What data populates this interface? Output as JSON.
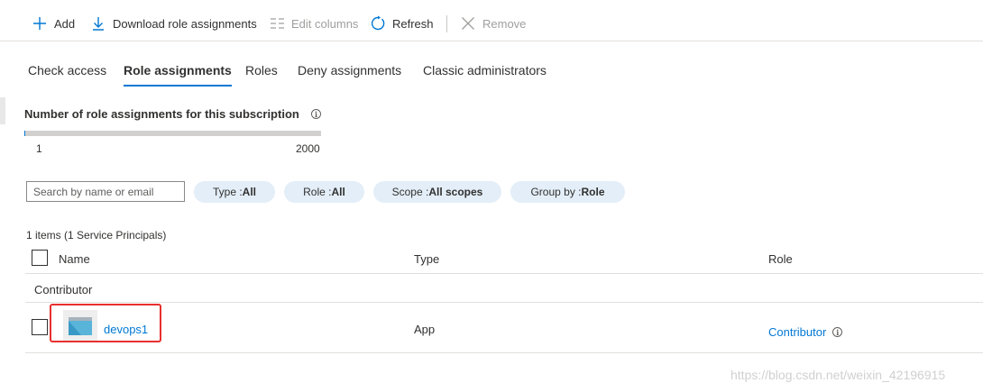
{
  "toolbar": {
    "add_label": "Add",
    "download_label": "Download role assignments",
    "edit_columns_label": "Edit columns",
    "refresh_label": "Refresh",
    "remove_label": "Remove"
  },
  "tabs": [
    {
      "label": "Check access",
      "active": false
    },
    {
      "label": "Role assignments",
      "active": true
    },
    {
      "label": "Roles",
      "active": false
    },
    {
      "label": "Deny assignments",
      "active": false
    },
    {
      "label": "Classic administrators",
      "active": false
    }
  ],
  "assignment_count": {
    "title": "Number of role assignments for this subscription",
    "current": 1,
    "min_label": "1",
    "max_label": "2000",
    "fill_fraction": 0.0005
  },
  "filters": {
    "search_placeholder": "Search by name or email",
    "type": {
      "label": "Type : ",
      "value": "All"
    },
    "role": {
      "label": "Role : ",
      "value": "All"
    },
    "scope": {
      "label": "Scope : ",
      "value": "All scopes"
    },
    "group_by": {
      "label": "Group by : ",
      "value": "Role"
    }
  },
  "grid": {
    "items_count": "1 items (1 Service Principals)",
    "columns": [
      "Name",
      "Type",
      "Role"
    ],
    "groups": [
      {
        "label": "Contributor",
        "rows": [
          {
            "name": "devops1",
            "type": "App",
            "role": "Contributor"
          }
        ]
      }
    ]
  },
  "watermark": "https://blog.csdn.net/weixin_42196915",
  "colors": {
    "accent": "#0078d4",
    "pill_bg": "#e3eef8",
    "highlight_border": "#e8302f"
  }
}
